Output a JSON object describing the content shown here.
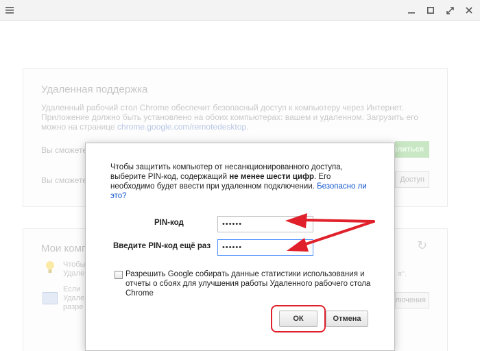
{
  "titlebar": {
    "menu_icon": "menu-icon",
    "minimize_icon": "minimize-icon",
    "maximize_icon": "maximize-icon",
    "fullscreen_icon": "fullscreen-icon",
    "close_icon": "close-icon"
  },
  "background": {
    "remote_support": {
      "title": "Удаленная поддержка",
      "desc_before": "Удаленный рабочий стол Chrome обеспечит безопасный доступ к компьютеру через Интернет. Приложение должно быть установлено на обоих компьютерах: вашем и удаленном. Загрузить его можно на странице ",
      "desc_link": "chrome.google.com/remotedesktop",
      "desc_after": ".",
      "row1": "Вы сможете",
      "row2": "Вы сможете",
      "share_button": "делиться",
      "access_button": "Доступ"
    },
    "my_computers": {
      "title": "Мои комп",
      "text1_line1": "Чтобы",
      "text1_line2": "Удале",
      "text2_line1": "Если",
      "text2_line2": "Удале",
      "text2_line3": "разре",
      "tail_text": "я\".",
      "connect_button": "лючения"
    }
  },
  "dialog": {
    "intro_part1": "Чтобы защитить компьютер от несанкционированного доступа, выберите PIN-код, содержащий ",
    "intro_bold": "не менее шести цифр",
    "intro_part2": ". Его необходимо будет ввести при удаленном подключении. ",
    "intro_link": "Безопасно ли это?",
    "pin_label": "PIN-код",
    "pin_value": "••••••",
    "pin_confirm_label": "Введите PIN-код ещё раз",
    "pin_confirm_value": "••••••",
    "consent_text": "Разрешить Google собирать данные статистики использования и отчеты о сбоях для улучшения работы Удаленного рабочего стола Chrome",
    "ok_button": "ОК",
    "cancel_button": "Отмена"
  },
  "colors": {
    "annotation": "#e0202a",
    "link": "#1155cc",
    "focus_border": "#4d90fe"
  }
}
